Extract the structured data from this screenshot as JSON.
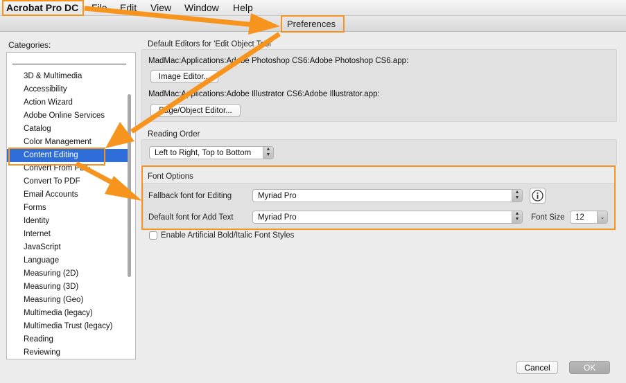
{
  "menubar": {
    "app_name": "Acrobat Pro DC",
    "items": [
      "File",
      "Edit",
      "View",
      "Window",
      "Help"
    ]
  },
  "dialog": {
    "title": "Preferences"
  },
  "categories": {
    "label": "Categories:",
    "items": [
      "3D & Multimedia",
      "Accessibility",
      "Action Wizard",
      "Adobe Online Services",
      "Catalog",
      "Color Management",
      "Content Editing",
      "Convert From PDF",
      "Convert To PDF",
      "Email Accounts",
      "Forms",
      "Identity",
      "Internet",
      "JavaScript",
      "Language",
      "Measuring (2D)",
      "Measuring (3D)",
      "Measuring (Geo)",
      "Multimedia (legacy)",
      "Multimedia Trust (legacy)",
      "Reading",
      "Reviewing"
    ],
    "selected": "Content Editing"
  },
  "editors": {
    "section_label": "Default Editors for 'Edit Object Tool'",
    "image_path": "MadMac:Applications:Adobe Photoshop CS6:Adobe Photoshop CS6.app:",
    "image_button": "Image Editor...",
    "page_path": "MadMac:Applications:Adobe Illustrator CS6:Adobe Illustrator.app:",
    "page_button": "Page/Object Editor..."
  },
  "reading_order": {
    "section_label": "Reading Order",
    "value": "Left to Right, Top to Bottom"
  },
  "font_options": {
    "section_label": "Font Options",
    "fallback_label": "Fallback font for Editing",
    "fallback_value": "Myriad Pro",
    "default_label": "Default font for Add Text",
    "default_value": "Myriad Pro",
    "size_label": "Font Size",
    "size_value": "12",
    "info_icon": "info-circle-icon",
    "checkbox_label": "Enable Artificial Bold/Italic Font Styles",
    "checkbox_checked": false
  },
  "footer": {
    "cancel": "Cancel",
    "ok": "OK"
  },
  "colors": {
    "annotation": "#f7941d",
    "selection": "#2f6ed8",
    "accent_text": "#ffffff"
  }
}
